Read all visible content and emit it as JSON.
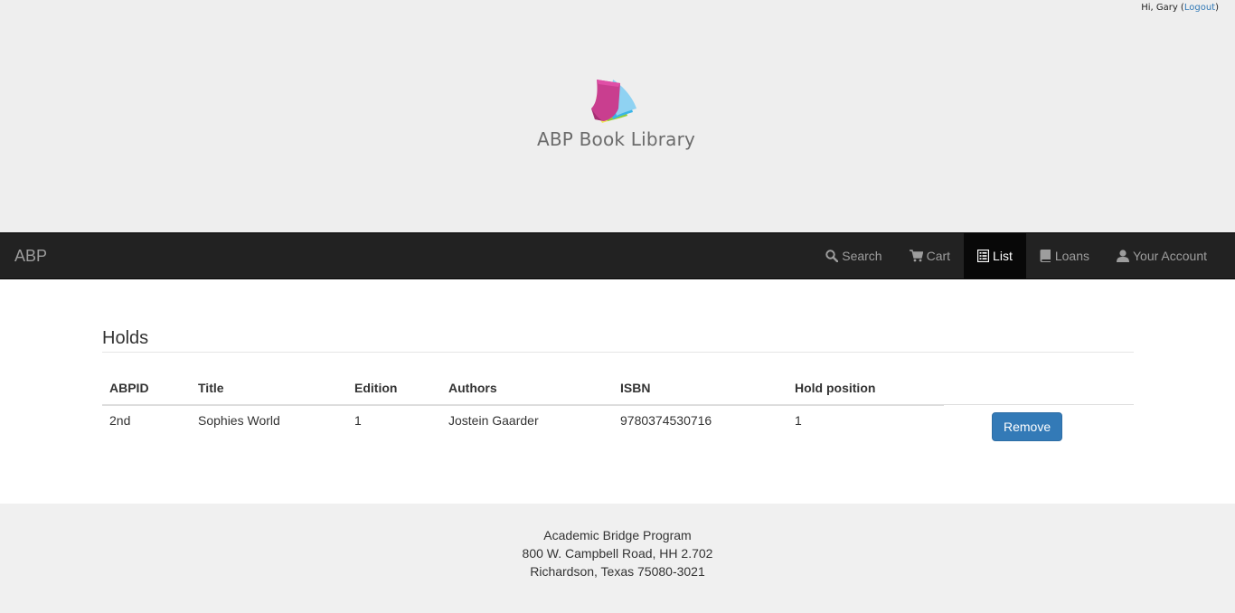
{
  "user": {
    "greeting": "Hi, Gary (",
    "logout_label": "Logout",
    "greeting_close": ")"
  },
  "logo": {
    "text": "ABP Book Library"
  },
  "navbar": {
    "brand": "ABP",
    "items": [
      {
        "label": "Search",
        "icon": "search-icon",
        "active": false
      },
      {
        "label": "Cart",
        "icon": "cart-icon",
        "active": false
      },
      {
        "label": "List",
        "icon": "list-icon",
        "active": true
      },
      {
        "label": "Loans",
        "icon": "book-icon",
        "active": false
      },
      {
        "label": "Your Account",
        "icon": "user-icon",
        "active": false
      }
    ]
  },
  "holds": {
    "title": "Holds",
    "columns": [
      "ABPID",
      "Title",
      "Edition",
      "Authors",
      "ISBN",
      "Hold position"
    ],
    "rows": [
      {
        "abpid": "2nd",
        "title": "Sophies World",
        "edition": "1",
        "authors": "Jostein Gaarder",
        "isbn": "9780374530716",
        "hold_position": "1",
        "action_label": "Remove"
      }
    ]
  },
  "footer": {
    "line1": "Academic Bridge Program",
    "line2": "800 W. Campbell Road, HH 2.702",
    "line3": "Richardson, Texas 75080-3021"
  },
  "colors": {
    "navbar_bg": "#222222",
    "active_bg": "#080808",
    "primary_button": "#337ab7",
    "link": "#337ab7",
    "header_bg": "#eeeeee",
    "footer_bg": "#f0f0f0"
  }
}
